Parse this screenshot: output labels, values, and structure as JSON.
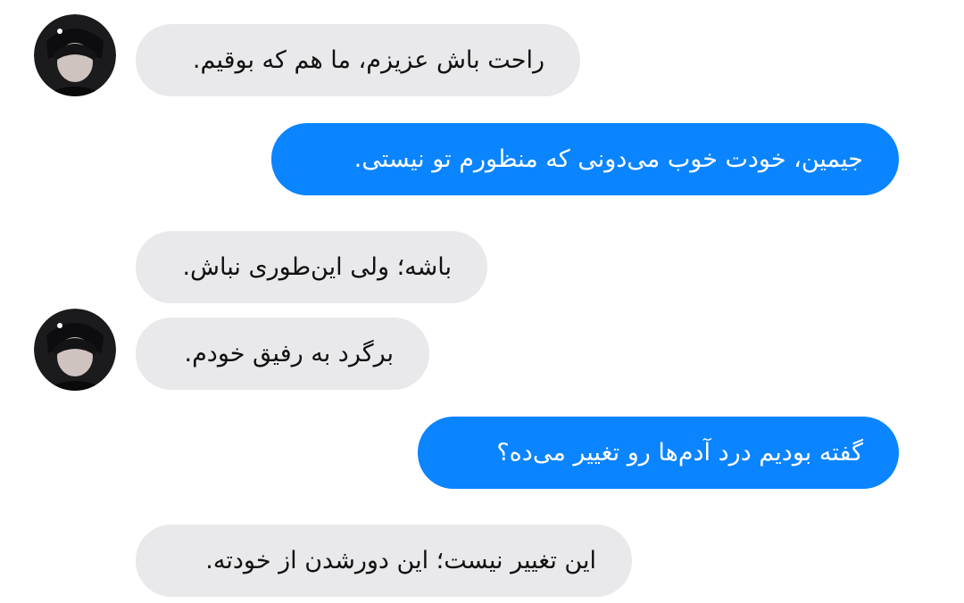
{
  "chat": {
    "messages": [
      {
        "sender": "other",
        "text": "راحت باش عزیزم، ما هم که بوقیم."
      },
      {
        "sender": "me",
        "text": "جیمین، خودت خوب می‌دونی که منظورم تو نیستی."
      },
      {
        "sender": "other",
        "text": "باشه؛ ولی این‌طوری نباش."
      },
      {
        "sender": "other",
        "text": "برگرد به رفیق خودم."
      },
      {
        "sender": "me",
        "text": "گفته بودیم درد آدم‌ها رو تغییر می‌ده؟"
      },
      {
        "sender": "other",
        "text": "این تغییر نیست؛ این دورشدن از خودته."
      }
    ]
  },
  "colors": {
    "incoming_bubble": "#e9e9eb",
    "outgoing_bubble": "#0a84ff",
    "incoming_text": "#111111",
    "outgoing_text": "#ffffff"
  },
  "icons": {
    "avatar": "contact-avatar-icon"
  }
}
